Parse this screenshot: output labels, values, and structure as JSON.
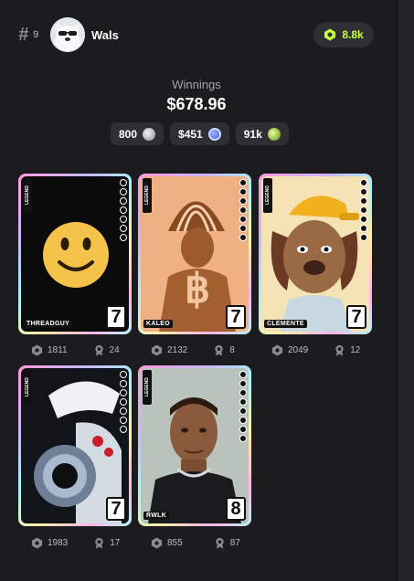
{
  "header": {
    "rank_symbol": "#",
    "rank": "9",
    "username": "Wals",
    "points": "8.8k"
  },
  "winnings": {
    "label": "Winnings",
    "amount": "$678.96",
    "stats": [
      {
        "value": "800",
        "icon": "silver-coin-icon"
      },
      {
        "value": "$451",
        "icon": "blue-token-icon"
      },
      {
        "value": "91k",
        "icon": "green-token-icon"
      }
    ]
  },
  "cards": [
    {
      "tag": "LEGEND",
      "name": "THREADGUY",
      "level": "7",
      "score": "1811",
      "medals": "24"
    },
    {
      "tag": "LEGEND",
      "name": "KALEO",
      "level": "7",
      "score": "2132",
      "medals": "8"
    },
    {
      "tag": "LEGEND",
      "name": "CLEMENTE",
      "level": "7",
      "score": "2049",
      "medals": "12"
    },
    {
      "tag": "LEGEND",
      "name": "",
      "level": "7",
      "score": "1983",
      "medals": "17"
    },
    {
      "tag": "LEGEND",
      "name": "RWLK",
      "level": "8",
      "score": "855",
      "medals": "87"
    }
  ],
  "colors": {
    "accent_green": "#c8ff3d",
    "background": "#1c1c1e",
    "pill": "#2f2f33"
  }
}
